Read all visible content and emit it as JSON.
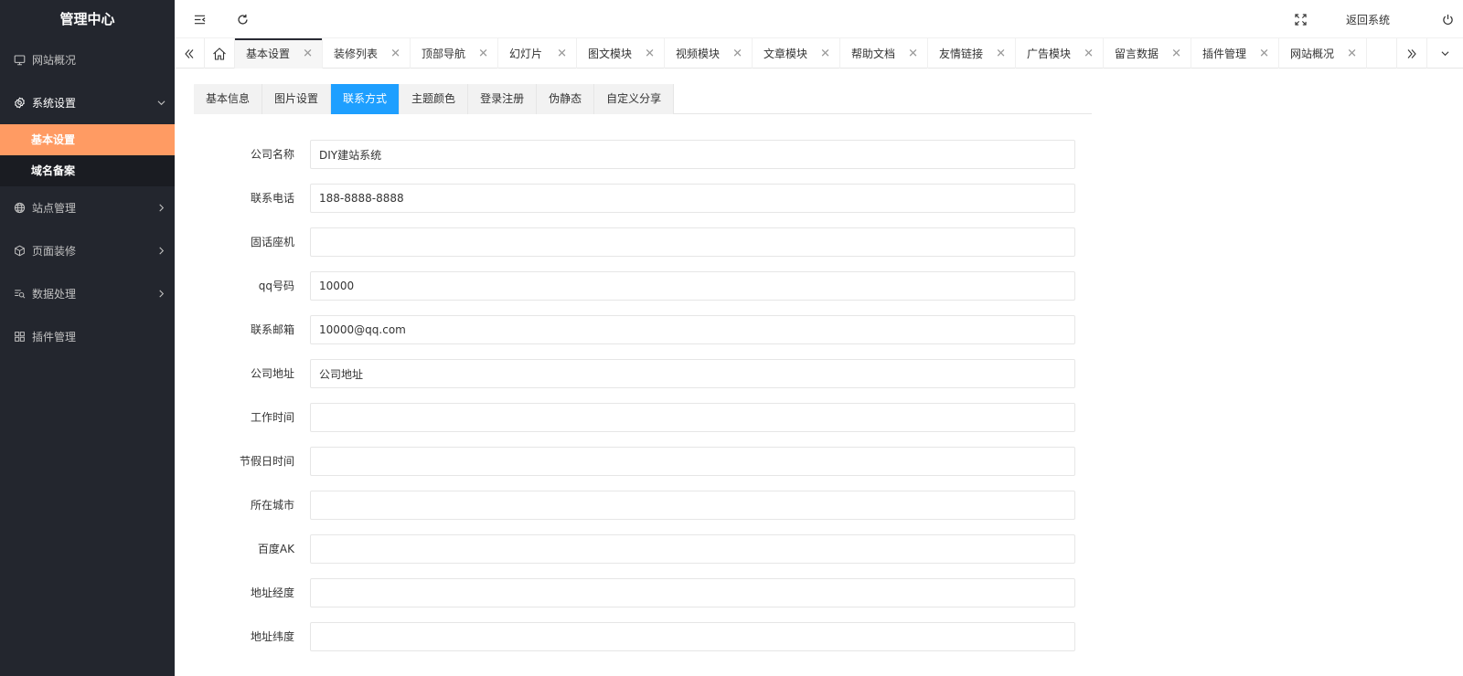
{
  "colors": {
    "sidebar_bg": "#23262e",
    "active_sub": "#ff9b63",
    "active_subtab": "#1e9fff"
  },
  "sidebar": {
    "title": "管理中心",
    "items": [
      {
        "label": "网站概况",
        "icon": "monitor-icon"
      },
      {
        "label": "系统设置",
        "icon": "gear-icon",
        "open": true,
        "children": [
          {
            "label": "基本设置",
            "active": true
          },
          {
            "label": "域名备案"
          }
        ]
      },
      {
        "label": "站点管理",
        "icon": "globe-icon"
      },
      {
        "label": "页面装修",
        "icon": "cube-icon"
      },
      {
        "label": "数据处理",
        "icon": "data-search-icon"
      },
      {
        "label": "插件管理",
        "icon": "grid-icon"
      }
    ]
  },
  "header": {
    "return_label": "返回系统"
  },
  "tabs": [
    {
      "label": "基本设置",
      "active": true
    },
    {
      "label": "装修列表"
    },
    {
      "label": "顶部导航"
    },
    {
      "label": "幻灯片"
    },
    {
      "label": "图文模块"
    },
    {
      "label": "视频模块"
    },
    {
      "label": "文章模块"
    },
    {
      "label": "帮助文档"
    },
    {
      "label": "友情链接"
    },
    {
      "label": "广告模块"
    },
    {
      "label": "留言数据"
    },
    {
      "label": "插件管理"
    },
    {
      "label": "网站概况"
    }
  ],
  "subtabs": [
    {
      "label": "基本信息"
    },
    {
      "label": "图片设置"
    },
    {
      "label": "联系方式",
      "active": true
    },
    {
      "label": "主题颜色"
    },
    {
      "label": "登录注册"
    },
    {
      "label": "伪静态"
    },
    {
      "label": "自定义分享"
    }
  ],
  "form": {
    "fields": [
      {
        "label": "公司名称",
        "value": "DIY建站系统"
      },
      {
        "label": "联系电话",
        "value": "188-8888-8888"
      },
      {
        "label": "固话座机",
        "value": ""
      },
      {
        "label": "qq号码",
        "value": "10000"
      },
      {
        "label": "联系邮箱",
        "value": "10000@qq.com"
      },
      {
        "label": "公司地址",
        "value": "公司地址"
      },
      {
        "label": "工作时间",
        "value": ""
      },
      {
        "label": "节假日时间",
        "value": ""
      },
      {
        "label": "所在城市",
        "value": ""
      },
      {
        "label": "百度AK",
        "value": ""
      },
      {
        "label": "地址经度",
        "value": ""
      },
      {
        "label": "地址纬度",
        "value": ""
      }
    ]
  }
}
